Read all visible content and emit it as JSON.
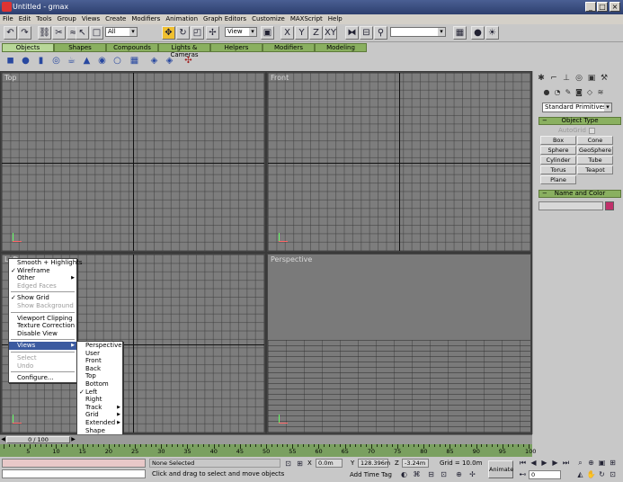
{
  "window": {
    "title": "Untitled - gmax",
    "controls": [
      "_",
      "□",
      "×"
    ]
  },
  "menu": [
    "File",
    "Edit",
    "Tools",
    "Group",
    "Views",
    "Create",
    "Modifiers",
    "Animation",
    "Graph Editors",
    "Customize",
    "MAXScript",
    "Help"
  ],
  "toolbar": {
    "selection_filter": "All",
    "ref_coord": "View",
    "named_sel": ""
  },
  "tabs": [
    "Objects",
    "Shapes",
    "Compounds",
    "Lights & Cameras",
    "Helpers",
    "Modifiers",
    "Modeling"
  ],
  "viewports": {
    "top": "Top",
    "front": "Front",
    "left": "Left",
    "perspective": "Perspective"
  },
  "context_menu": {
    "items": [
      {
        "label": "Smooth + Highlights",
        "checked": false,
        "disabled": false
      },
      {
        "label": "Wireframe",
        "checked": true,
        "disabled": false
      },
      {
        "label": "Other",
        "checked": false,
        "disabled": false,
        "submenu": true
      },
      {
        "label": "Edged Faces",
        "checked": false,
        "disabled": true
      }
    ],
    "items2": [
      {
        "label": "Show Grid",
        "checked": true,
        "disabled": false
      },
      {
        "label": "Show Background",
        "checked": false,
        "disabled": true
      }
    ],
    "items3": [
      "Viewport Clipping",
      "Texture Correction",
      "Disable View"
    ],
    "views_label": "Views",
    "items4": [
      {
        "label": "Select",
        "disabled": true
      },
      {
        "label": "Undo",
        "disabled": true
      }
    ],
    "configure": "Configure..."
  },
  "views_submenu": [
    {
      "label": "Perspective",
      "checked": false,
      "submenu": false
    },
    {
      "label": "User",
      "checked": false,
      "submenu": false
    },
    {
      "label": "Front",
      "checked": false,
      "submenu": false
    },
    {
      "label": "Back",
      "checked": false,
      "submenu": false
    },
    {
      "label": "Top",
      "checked": false,
      "submenu": false
    },
    {
      "label": "Bottom",
      "checked": false,
      "submenu": false
    },
    {
      "label": "Left",
      "checked": true,
      "submenu": false
    },
    {
      "label": "Right",
      "checked": false,
      "submenu": false
    },
    {
      "label": "Track",
      "checked": false,
      "submenu": true
    },
    {
      "label": "Grid",
      "checked": false,
      "submenu": true
    },
    {
      "label": "Extended",
      "checked": false,
      "submenu": true
    },
    {
      "label": "Shape",
      "checked": false,
      "submenu": false
    }
  ],
  "command_panel": {
    "category": "Standard Primitives",
    "object_type_title": "Object Type",
    "autogrid": "AutoGrid",
    "buttons": [
      "Box",
      "Cone",
      "Sphere",
      "GeoSphere",
      "Cylinder",
      "Tube",
      "Torus",
      "Teapot",
      "Plane"
    ],
    "name_color_title": "Name and Color",
    "name_value": "",
    "color": "#c0306a"
  },
  "timeline": {
    "slider_label": "0 / 100",
    "ticks": [
      "5",
      "10",
      "15",
      "20",
      "25",
      "30",
      "35",
      "40",
      "45",
      "50",
      "55",
      "60",
      "65",
      "70",
      "75",
      "80",
      "85",
      "90",
      "95",
      "100"
    ]
  },
  "status": {
    "selection": "None Selected",
    "prompt": "Click and drag to select and move objects",
    "x_label": "X",
    "x_value": "0.0m",
    "y_label": "Y",
    "y_value": "128.396m",
    "z_label": "Z",
    "z_value": "-3.24m",
    "grid": "Grid = 10.0m",
    "add_time_tag": "Add Time Tag",
    "animate": "Animate",
    "frame": "0"
  }
}
